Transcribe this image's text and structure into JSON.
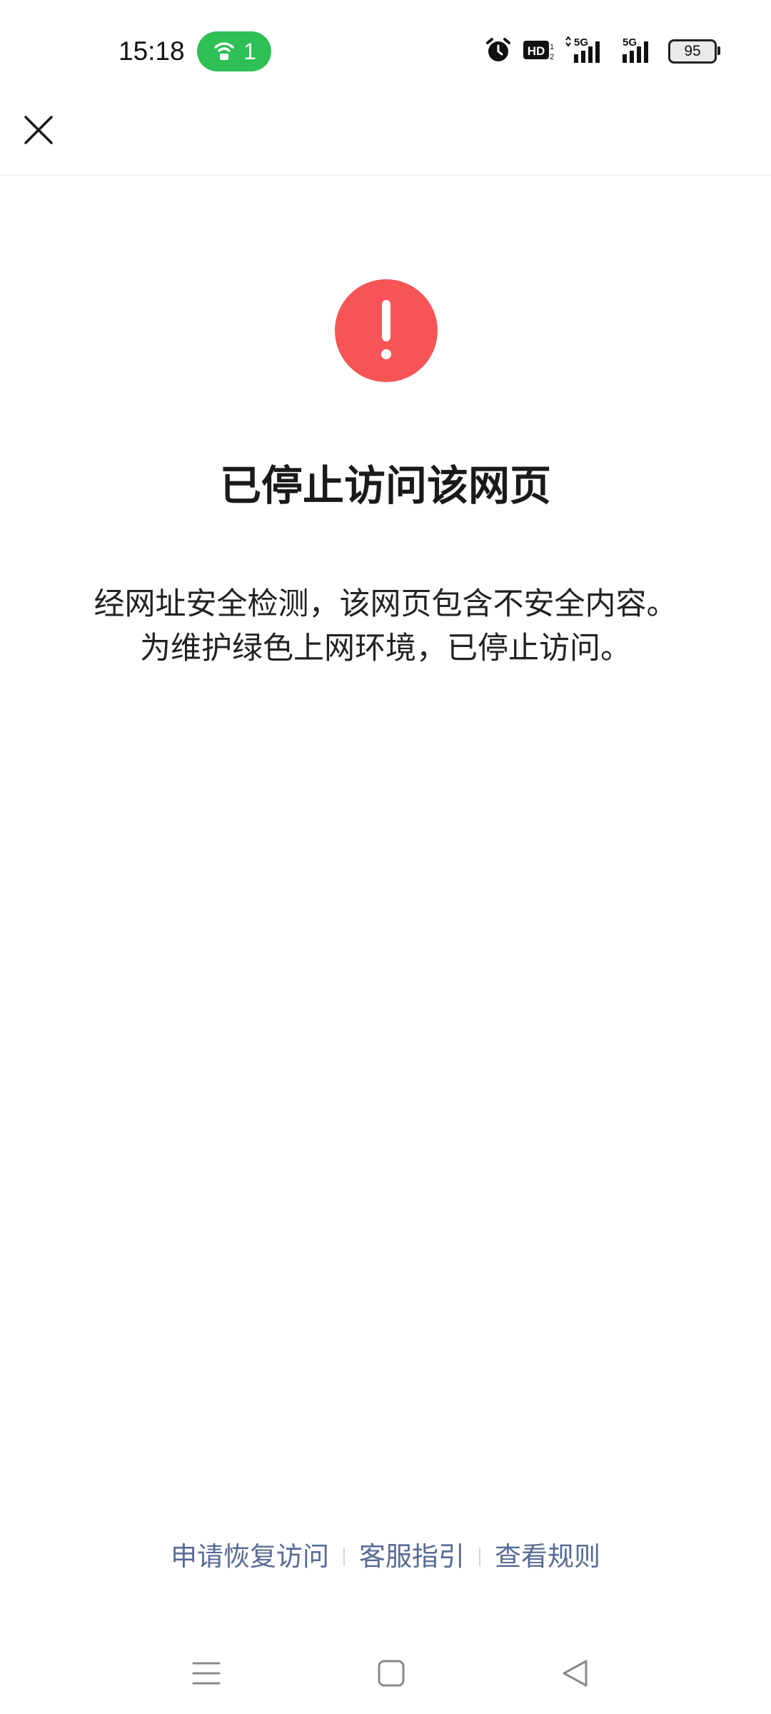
{
  "status_bar": {
    "time": "15:18",
    "hotspot_count": "1",
    "battery_level": "95",
    "network_label_1": "5G",
    "network_label_2": "5G",
    "hd_label": "HD",
    "hotspot_color": "#2ebf55",
    "icons": [
      "hotspot-icon",
      "alarm-icon",
      "hd-voice-icon",
      "signal-5g-icon",
      "signal-5g-icon",
      "battery-icon"
    ]
  },
  "header": {
    "close_icon": "close-icon"
  },
  "content": {
    "warning_icon": "exclamation-icon",
    "warning_color": "#f65456",
    "title": "已停止访问该网页",
    "description_line1": "经网址安全检测，该网页包含不安全内容。",
    "description_line2": "为维护绿色上网环境，已停止访问。"
  },
  "footer": {
    "link_color": "#576b95",
    "links": [
      {
        "label": "申请恢复访问"
      },
      {
        "label": "客服指引"
      },
      {
        "label": "查看规则"
      }
    ]
  },
  "system_nav": {
    "icons": [
      "menu-icon",
      "home-icon",
      "back-icon"
    ]
  }
}
